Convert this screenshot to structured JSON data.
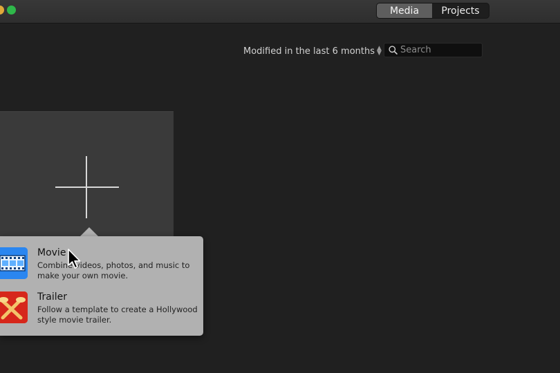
{
  "toolbar": {
    "tabs": [
      {
        "label": "Media",
        "active": true
      },
      {
        "label": "Projects",
        "active": false
      }
    ]
  },
  "browser": {
    "filter_label": "Modified in the last 6 months",
    "search": {
      "placeholder": "Search",
      "value": ""
    }
  },
  "new_project": {
    "plus_icon": "plus-icon",
    "menu": [
      {
        "title": "Movie",
        "description": "Combine videos, photos, and music to make your own movie.",
        "icon": "film-strip-icon",
        "icon_color": "#2a86f0"
      },
      {
        "title": "Trailer",
        "description": "Follow a template to create a Hollywood style movie trailer.",
        "icon": "clapper-icon",
        "icon_color": "#d6271b"
      }
    ]
  },
  "colors": {
    "background": "#202020",
    "popover": "#b1b1b1",
    "active_tab": "#5e5e5e"
  }
}
